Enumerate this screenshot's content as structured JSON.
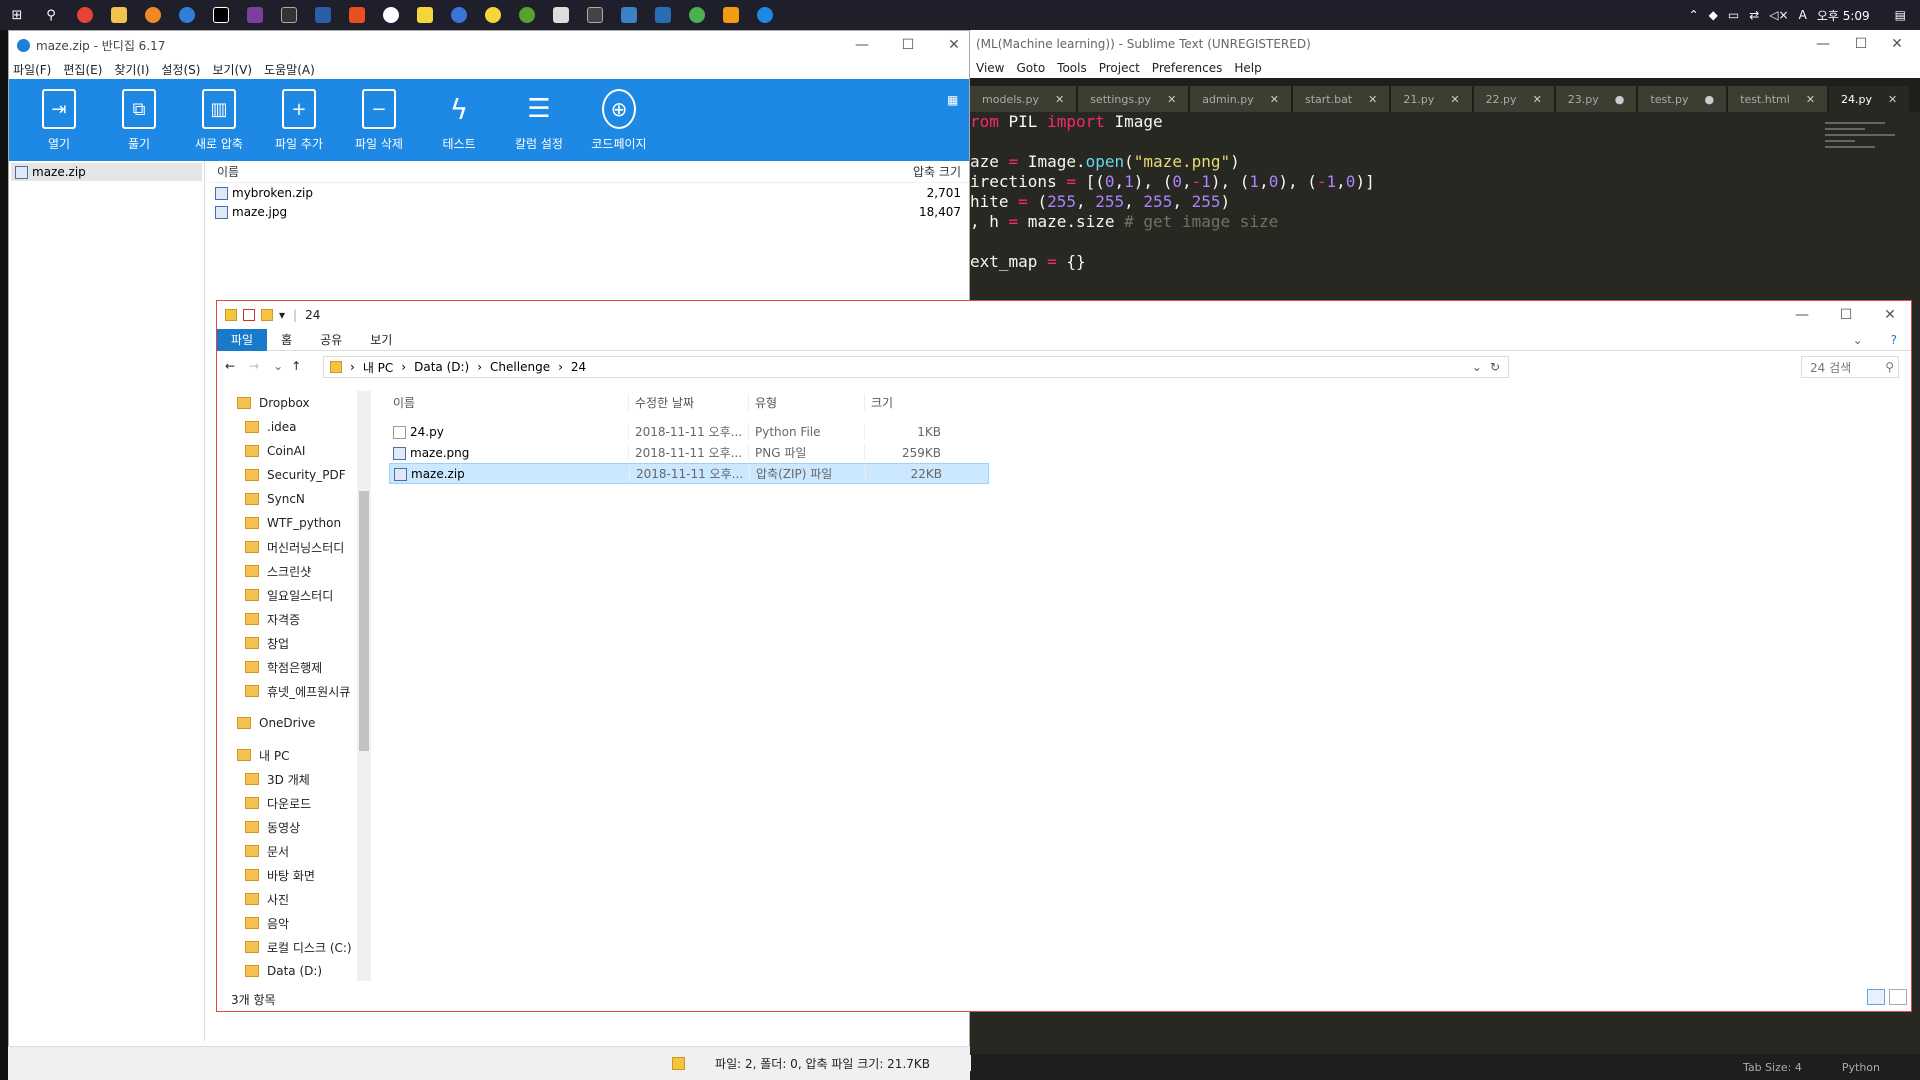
{
  "taskbar": {
    "icons": [
      "windows-start",
      "search",
      "chrome",
      "file-explorer",
      "search-app",
      "firefox",
      "pycharm",
      "onenote",
      "cmd",
      "powershell",
      "app",
      "app",
      "notes",
      "app",
      "app",
      "app",
      "app",
      "app",
      "app",
      "app",
      "app",
      "app"
    ],
    "tray": {
      "time": "오후 5:09",
      "ime": "A"
    }
  },
  "bandizip": {
    "title": "maze.zip - 반디집 6.17",
    "menu": [
      "파일(F)",
      "편집(E)",
      "찾기(I)",
      "설정(S)",
      "보기(V)",
      "도움말(A)"
    ],
    "toolbar": [
      "열기",
      "풀기",
      "새로 압축",
      "파일 추가",
      "파일 삭제",
      "테스트",
      "칼럼 설정",
      "코드페이지"
    ],
    "tree_item": "maze.zip",
    "columns": {
      "name": "이름",
      "size": "압축 크기"
    },
    "files": [
      {
        "name": "mybroken.zip",
        "size": "2,701"
      },
      {
        "name": "maze.jpg",
        "size": "18,407"
      }
    ],
    "status": "파일: 2, 폴더: 0, 압축 파일 크기: 21.7KB"
  },
  "sublime": {
    "title": "(ML(Machine learning)) - Sublime Text (UNREGISTERED)",
    "menu": [
      "View",
      "Goto",
      "Tools",
      "Project",
      "Preferences",
      "Help"
    ],
    "tabs": [
      "models.py",
      "settings.py",
      "admin.py",
      "start.bat",
      "21.py",
      "22.py",
      "23.py",
      "test.py",
      "test.html",
      "24.py"
    ],
    "active_tab": "24.py",
    "code": [
      "rom PIL import Image",
      "",
      "aze = Image.open(\"maze.png\")",
      "irections = [(0,1), (0,-1), (1,0), (-1,0)]",
      "hite = (255, 255, 255, 255)",
      ", h = maze.size # get image size",
      "",
      "ext_map = {}"
    ],
    "status": {
      "tab_size": "Tab Size: 4",
      "syntax": "Python"
    }
  },
  "explorer": {
    "title": "24",
    "ribbon": [
      "파일",
      "홈",
      "공유",
      "보기"
    ],
    "path": [
      "내 PC",
      "Data (D:)",
      "Chellenge",
      "24"
    ],
    "search_placeholder": "24 검색",
    "nav": [
      {
        "label": "Dropbox",
        "indent": 0
      },
      {
        "label": ".idea",
        "indent": 1
      },
      {
        "label": "CoinAI",
        "indent": 1
      },
      {
        "label": "Security_PDF",
        "indent": 1
      },
      {
        "label": "SyncN",
        "indent": 1
      },
      {
        "label": "WTF_python",
        "indent": 1
      },
      {
        "label": "머신러닝스터디",
        "indent": 1
      },
      {
        "label": "스크린샷",
        "indent": 1
      },
      {
        "label": "일요일스터디",
        "indent": 1
      },
      {
        "label": "자격증",
        "indent": 1
      },
      {
        "label": "창업",
        "indent": 1
      },
      {
        "label": "학점은행제",
        "indent": 1
      },
      {
        "label": "휴넷_에프원시큐",
        "indent": 1
      },
      {
        "label": "",
        "indent": 0
      },
      {
        "label": "OneDrive",
        "indent": 0
      },
      {
        "label": "",
        "indent": 0
      },
      {
        "label": "내 PC",
        "indent": 0
      },
      {
        "label": "3D 개체",
        "indent": 1
      },
      {
        "label": "다운로드",
        "indent": 1
      },
      {
        "label": "동영상",
        "indent": 1
      },
      {
        "label": "문서",
        "indent": 1
      },
      {
        "label": "바탕 화면",
        "indent": 1
      },
      {
        "label": "사진",
        "indent": 1
      },
      {
        "label": "음악",
        "indent": 1
      },
      {
        "label": "로컬 디스크 (C:)",
        "indent": 1
      },
      {
        "label": "Data (D:)",
        "indent": 1
      }
    ],
    "columns": {
      "name": "이름",
      "date": "수정한 날짜",
      "type": "유형",
      "size": "크기"
    },
    "files": [
      {
        "name": "24.py",
        "date": "2018-11-11 오후...",
        "type": "Python File",
        "size": "1KB"
      },
      {
        "name": "maze.png",
        "date": "2018-11-11 오후...",
        "type": "PNG 파일",
        "size": "259KB"
      },
      {
        "name": "maze.zip",
        "date": "2018-11-11 오후...",
        "type": "압축(ZIP) 파일",
        "size": "22KB"
      }
    ],
    "item_count": "3개 항목"
  }
}
